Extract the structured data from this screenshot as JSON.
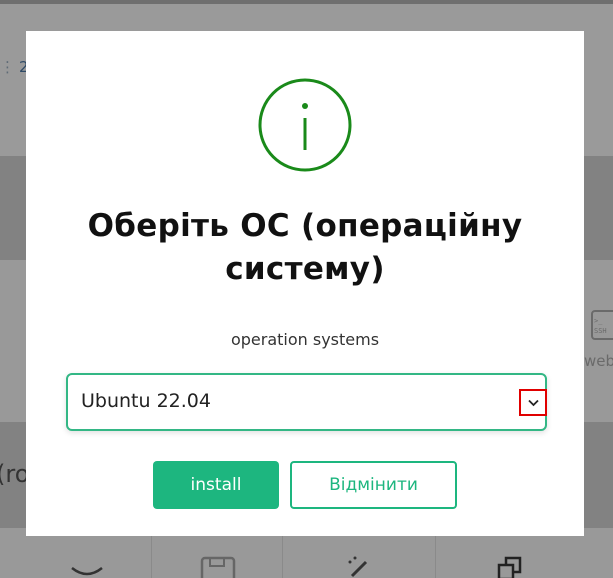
{
  "background": {
    "counter_text": "2",
    "side_text": "(ro",
    "web_label": "web"
  },
  "modal": {
    "icon": "info-circle-icon",
    "title": "Оберіть ОС (операційну системy)",
    "title_line1": "Оберіть ОС (операційну",
    "title_line2": "системy)",
    "select_label": "operation systems",
    "select_value": "Ubuntu 22.04",
    "install_label": "install",
    "cancel_label": "Відмінити"
  },
  "colors": {
    "accent": "#1db67f",
    "icon_green": "#1a8a1a",
    "highlight": "#e00000"
  }
}
